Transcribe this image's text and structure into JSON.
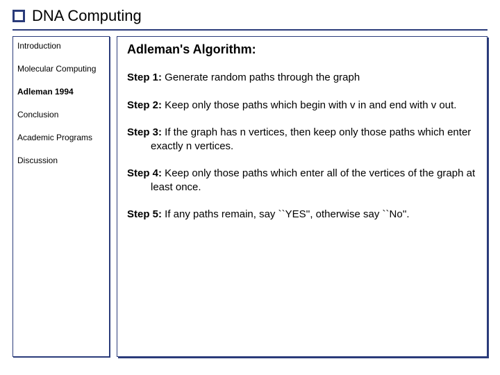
{
  "title": "DNA Computing",
  "sidebar": {
    "items": [
      {
        "label": "Introduction",
        "active": false
      },
      {
        "label": "Molecular Computing",
        "active": false
      },
      {
        "label": "Adleman 1994",
        "active": true
      },
      {
        "label": "Conclusion",
        "active": false
      },
      {
        "label": "Academic Programs",
        "active": false
      },
      {
        "label": "Discussion",
        "active": false
      }
    ]
  },
  "content": {
    "heading": "Adleman's Algorithm:",
    "steps": [
      {
        "label": "Step 1:",
        "text": " Generate random paths through the graph"
      },
      {
        "label": "Step 2:",
        "text": " Keep only those paths which begin with v in and end with v out."
      },
      {
        "label": "Step 3:",
        "text": " If the graph has n vertices, then keep only those paths which enter exactly n vertices."
      },
      {
        "label": "Step 4:",
        "text": " Keep only those paths which enter all of the vertices of the graph at least once."
      },
      {
        "label": "Step 5:",
        "text": " If any paths remain, say ``YES'', otherwise say ``No''."
      }
    ]
  }
}
